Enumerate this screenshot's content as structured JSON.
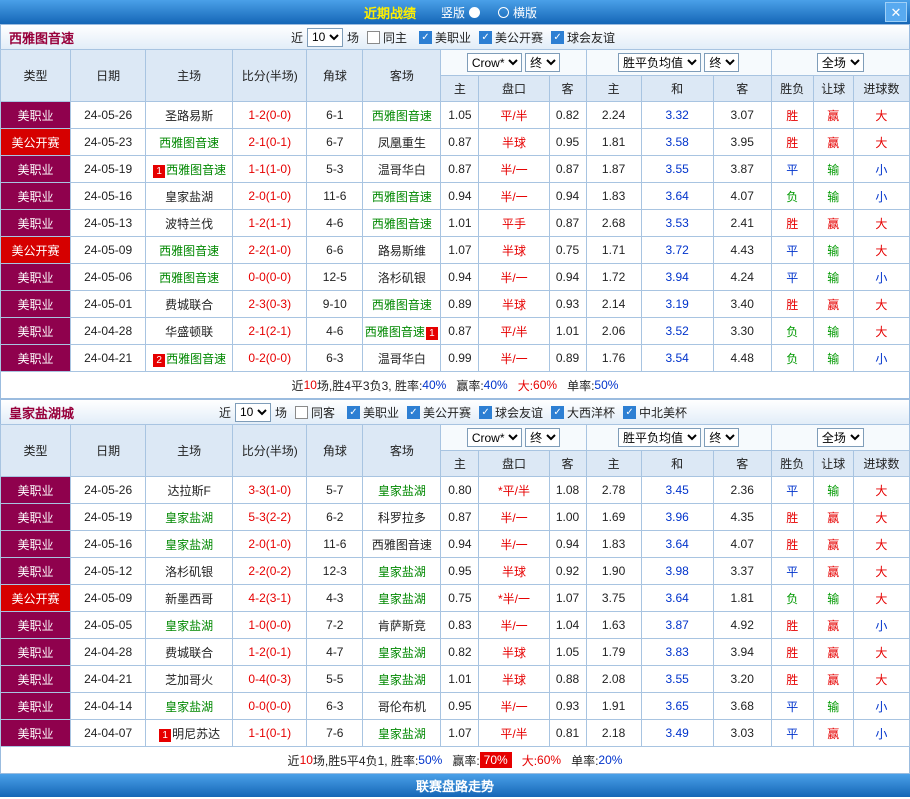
{
  "topbar": {
    "title": "近期战绩",
    "vertical_label": "竖版",
    "horizontal_label": "横版",
    "close_label": "✕"
  },
  "bottombar": {
    "title": "联赛盘路走势"
  },
  "colors": {
    "bar_blue": "#1566b6",
    "mls_maroon": "#8f014d",
    "open_red": "#d60000",
    "self_team_green": "#008800",
    "score_red": "#e60000",
    "draw_odds_blue": "#0033cc"
  },
  "table_header": {
    "type": "类型",
    "date": "日期",
    "home": "主场",
    "score": "比分(半场)",
    "corner": "角球",
    "away": "客场",
    "asia_home": "主",
    "asia_line": "盘口",
    "asia_away": "客",
    "euro_home": "主",
    "euro_draw": "和",
    "euro_away": "客",
    "result": "胜负",
    "cover": "让球",
    "goal": "进球数"
  },
  "sections": [
    {
      "team_title": "西雅图音速",
      "filter": {
        "near": "近",
        "count": "10",
        "games": "场",
        "same": "同主",
        "same_checked": false,
        "leagues": [
          {
            "label": "美职业",
            "checked": true
          },
          {
            "label": "美公开赛",
            "checked": true
          },
          {
            "label": "球会友谊",
            "checked": true
          }
        ]
      },
      "selects": {
        "company": "Crow*",
        "company_time": "终",
        "euro": "胜平负均值",
        "euro_time": "终",
        "scope": "全场"
      },
      "rows": [
        {
          "type": "美职业",
          "tc": "mls",
          "date": "24-05-26",
          "home": {
            "name": "圣路易斯",
            "self": false
          },
          "score": "1-2(0-0)",
          "corner": "6-1",
          "away": {
            "name": "西雅图音速",
            "self": true
          },
          "ah": "1.05",
          "line": "平/半",
          "aa": "0.82",
          "eh": "2.24",
          "ed": "3.32",
          "ea": "3.07",
          "res": "胜",
          "cov": "赢",
          "goal": "大"
        },
        {
          "type": "美公开赛",
          "tc": "open",
          "date": "24-05-23",
          "home": {
            "name": "西雅图音速",
            "self": true
          },
          "score": "2-1(0-1)",
          "corner": "6-7",
          "away": {
            "name": "凤凰重生",
            "self": false
          },
          "ah": "0.87",
          "line": "半球",
          "aa": "0.95",
          "eh": "1.81",
          "ed": "3.58",
          "ea": "3.95",
          "res": "胜",
          "cov": "赢",
          "goal": "大"
        },
        {
          "type": "美职业",
          "tc": "mls",
          "date": "24-05-19",
          "home": {
            "name": "西雅图音速",
            "self": true,
            "badge": "1",
            "badge_pos": "before"
          },
          "score": "1-1(1-0)",
          "corner": "5-3",
          "away": {
            "name": "温哥华白",
            "self": false
          },
          "ah": "0.87",
          "line": "半/一",
          "aa": "0.87",
          "eh": "1.87",
          "ed": "3.55",
          "ea": "3.87",
          "res": "平",
          "cov": "输",
          "goal": "小"
        },
        {
          "type": "美职业",
          "tc": "mls",
          "date": "24-05-16",
          "home": {
            "name": "皇家盐湖",
            "self": false
          },
          "score": "2-0(1-0)",
          "corner": "11-6",
          "away": {
            "name": "西雅图音速",
            "self": true
          },
          "ah": "0.94",
          "line": "半/一",
          "aa": "0.94",
          "eh": "1.83",
          "ed": "3.64",
          "ea": "4.07",
          "res": "负",
          "cov": "输",
          "goal": "小"
        },
        {
          "type": "美职业",
          "tc": "mls",
          "date": "24-05-13",
          "home": {
            "name": "波特兰伐",
            "self": false
          },
          "score": "1-2(1-1)",
          "corner": "4-6",
          "away": {
            "name": "西雅图音速",
            "self": true
          },
          "ah": "1.01",
          "line": "平手",
          "aa": "0.87",
          "eh": "2.68",
          "ed": "3.53",
          "ea": "2.41",
          "res": "胜",
          "cov": "赢",
          "goal": "大"
        },
        {
          "type": "美公开赛",
          "tc": "open",
          "date": "24-05-09",
          "home": {
            "name": "西雅图音速",
            "self": true
          },
          "score": "2-2(1-0)",
          "corner": "6-6",
          "away": {
            "name": "路易斯维",
            "self": false
          },
          "ah": "1.07",
          "line": "半球",
          "aa": "0.75",
          "eh": "1.71",
          "ed": "3.72",
          "ea": "4.43",
          "res": "平",
          "cov": "输",
          "goal": "大"
        },
        {
          "type": "美职业",
          "tc": "mls",
          "date": "24-05-06",
          "home": {
            "name": "西雅图音速",
            "self": true
          },
          "score": "0-0(0-0)",
          "corner": "12-5",
          "away": {
            "name": "洛杉矶银",
            "self": false
          },
          "ah": "0.94",
          "line": "半/一",
          "aa": "0.94",
          "eh": "1.72",
          "ed": "3.94",
          "ea": "4.24",
          "res": "平",
          "cov": "输",
          "goal": "小"
        },
        {
          "type": "美职业",
          "tc": "mls",
          "date": "24-05-01",
          "home": {
            "name": "费城联合",
            "self": false
          },
          "score": "2-3(0-3)",
          "corner": "9-10",
          "away": {
            "name": "西雅图音速",
            "self": true
          },
          "ah": "0.89",
          "line": "半球",
          "aa": "0.93",
          "eh": "2.14",
          "ed": "3.19",
          "ea": "3.40",
          "res": "胜",
          "cov": "赢",
          "goal": "大"
        },
        {
          "type": "美职业",
          "tc": "mls",
          "date": "24-04-28",
          "home": {
            "name": "华盛顿联",
            "self": false
          },
          "score": "2-1(2-1)",
          "corner": "4-6",
          "away": {
            "name": "西雅图音速",
            "self": true,
            "badge": "1",
            "badge_pos": "after"
          },
          "ah": "0.87",
          "line": "平/半",
          "aa": "1.01",
          "eh": "2.06",
          "ed": "3.52",
          "ea": "3.30",
          "res": "负",
          "cov": "输",
          "goal": "大"
        },
        {
          "type": "美职业",
          "tc": "mls",
          "date": "24-04-21",
          "home": {
            "name": "西雅图音速",
            "self": true,
            "badge": "2",
            "badge_pos": "before"
          },
          "score": "0-2(0-0)",
          "corner": "6-3",
          "away": {
            "name": "温哥华白",
            "self": false
          },
          "ah": "0.99",
          "line": "半/一",
          "aa": "0.89",
          "eh": "1.76",
          "ed": "3.54",
          "ea": "4.48",
          "res": "负",
          "cov": "输",
          "goal": "小"
        }
      ],
      "summary": {
        "near": "近",
        "count": "10",
        "text1": "场,胜4平3负3, 胜率:",
        "win_rate": "40%",
        "text2": "赢率:",
        "cover_rate": "40%",
        "cover_hl": false,
        "text3": "大:",
        "big_rate": "60%",
        "text4": "单率:",
        "single_rate": "50%"
      }
    },
    {
      "team_title": "皇家盐湖城",
      "filter": {
        "near": "近",
        "count": "10",
        "games": "场",
        "same": "同客",
        "same_checked": false,
        "leagues": [
          {
            "label": "美职业",
            "checked": true
          },
          {
            "label": "美公开赛",
            "checked": true
          },
          {
            "label": "球会友谊",
            "checked": true
          },
          {
            "label": "大西洋杯",
            "checked": true
          },
          {
            "label": "中北美杯",
            "checked": true
          }
        ]
      },
      "selects": {
        "company": "Crow*",
        "company_time": "终",
        "euro": "胜平负均值",
        "euro_time": "终",
        "scope": "全场"
      },
      "rows": [
        {
          "type": "美职业",
          "tc": "mls",
          "date": "24-05-26",
          "home": {
            "name": "达拉斯F",
            "self": false
          },
          "score": "3-3(1-0)",
          "corner": "5-7",
          "away": {
            "name": "皇家盐湖",
            "self": true
          },
          "ah": "0.80",
          "line": "*平/半",
          "aa": "1.08",
          "eh": "2.78",
          "ed": "3.45",
          "ea": "2.36",
          "res": "平",
          "cov": "输",
          "goal": "大"
        },
        {
          "type": "美职业",
          "tc": "mls",
          "date": "24-05-19",
          "home": {
            "name": "皇家盐湖",
            "self": true
          },
          "score": "5-3(2-2)",
          "corner": "6-2",
          "away": {
            "name": "科罗拉多",
            "self": false
          },
          "ah": "0.87",
          "line": "半/一",
          "aa": "1.00",
          "eh": "1.69",
          "ed": "3.96",
          "ea": "4.35",
          "res": "胜",
          "cov": "赢",
          "goal": "大"
        },
        {
          "type": "美职业",
          "tc": "mls",
          "date": "24-05-16",
          "home": {
            "name": "皇家盐湖",
            "self": true
          },
          "score": "2-0(1-0)",
          "corner": "11-6",
          "away": {
            "name": "西雅图音速",
            "self": false
          },
          "ah": "0.94",
          "line": "半/一",
          "aa": "0.94",
          "eh": "1.83",
          "ed": "3.64",
          "ea": "4.07",
          "res": "胜",
          "cov": "赢",
          "goal": "大"
        },
        {
          "type": "美职业",
          "tc": "mls",
          "date": "24-05-12",
          "home": {
            "name": "洛杉矶银",
            "self": false
          },
          "score": "2-2(0-2)",
          "corner": "12-3",
          "away": {
            "name": "皇家盐湖",
            "self": true
          },
          "ah": "0.95",
          "line": "半球",
          "aa": "0.92",
          "eh": "1.90",
          "ed": "3.98",
          "ea": "3.37",
          "res": "平",
          "cov": "赢",
          "goal": "大"
        },
        {
          "type": "美公开赛",
          "tc": "open",
          "date": "24-05-09",
          "home": {
            "name": "新墨西哥",
            "self": false
          },
          "score": "4-2(3-1)",
          "corner": "4-3",
          "away": {
            "name": "皇家盐湖",
            "self": true
          },
          "ah": "0.75",
          "line": "*半/一",
          "aa": "1.07",
          "eh": "3.75",
          "ed": "3.64",
          "ea": "1.81",
          "res": "负",
          "cov": "输",
          "goal": "大"
        },
        {
          "type": "美职业",
          "tc": "mls",
          "date": "24-05-05",
          "home": {
            "name": "皇家盐湖",
            "self": true
          },
          "score": "1-0(0-0)",
          "corner": "7-2",
          "away": {
            "name": "肯萨斯竞",
            "self": false
          },
          "ah": "0.83",
          "line": "半/一",
          "aa": "1.04",
          "eh": "1.63",
          "ed": "3.87",
          "ea": "4.92",
          "res": "胜",
          "cov": "赢",
          "goal": "小"
        },
        {
          "type": "美职业",
          "tc": "mls",
          "date": "24-04-28",
          "home": {
            "name": "费城联合",
            "self": false
          },
          "score": "1-2(0-1)",
          "corner": "4-7",
          "away": {
            "name": "皇家盐湖",
            "self": true
          },
          "ah": "0.82",
          "line": "半球",
          "aa": "1.05",
          "eh": "1.79",
          "ed": "3.83",
          "ea": "3.94",
          "res": "胜",
          "cov": "赢",
          "goal": "大"
        },
        {
          "type": "美职业",
          "tc": "mls",
          "date": "24-04-21",
          "home": {
            "name": "芝加哥火",
            "self": false
          },
          "score": "0-4(0-3)",
          "corner": "5-5",
          "away": {
            "name": "皇家盐湖",
            "self": true
          },
          "ah": "1.01",
          "line": "半球",
          "aa": "0.88",
          "eh": "2.08",
          "ed": "3.55",
          "ea": "3.20",
          "res": "胜",
          "cov": "赢",
          "goal": "大"
        },
        {
          "type": "美职业",
          "tc": "mls",
          "date": "24-04-14",
          "home": {
            "name": "皇家盐湖",
            "self": true
          },
          "score": "0-0(0-0)",
          "corner": "6-3",
          "away": {
            "name": "哥伦布机",
            "self": false
          },
          "ah": "0.95",
          "line": "半/一",
          "aa": "0.93",
          "eh": "1.91",
          "ed": "3.65",
          "ea": "3.68",
          "res": "平",
          "cov": "输",
          "goal": "小"
        },
        {
          "type": "美职业",
          "tc": "mls",
          "date": "24-04-07",
          "home": {
            "name": "明尼苏达",
            "self": false,
            "badge": "1",
            "badge_pos": "before"
          },
          "score": "1-1(0-1)",
          "corner": "7-6",
          "away": {
            "name": "皇家盐湖",
            "self": true
          },
          "ah": "1.07",
          "line": "平/半",
          "aa": "0.81",
          "eh": "2.18",
          "ed": "3.49",
          "ea": "3.03",
          "res": "平",
          "cov": "赢",
          "goal": "小"
        }
      ],
      "summary": {
        "near": "近",
        "count": "10",
        "text1": "场,胜5平4负1, 胜率:",
        "win_rate": "50%",
        "text2": "赢率:",
        "cover_rate": "70%",
        "cover_hl": true,
        "text3": "大:",
        "big_rate": "60%",
        "text4": "单率:",
        "single_rate": "20%"
      }
    }
  ]
}
